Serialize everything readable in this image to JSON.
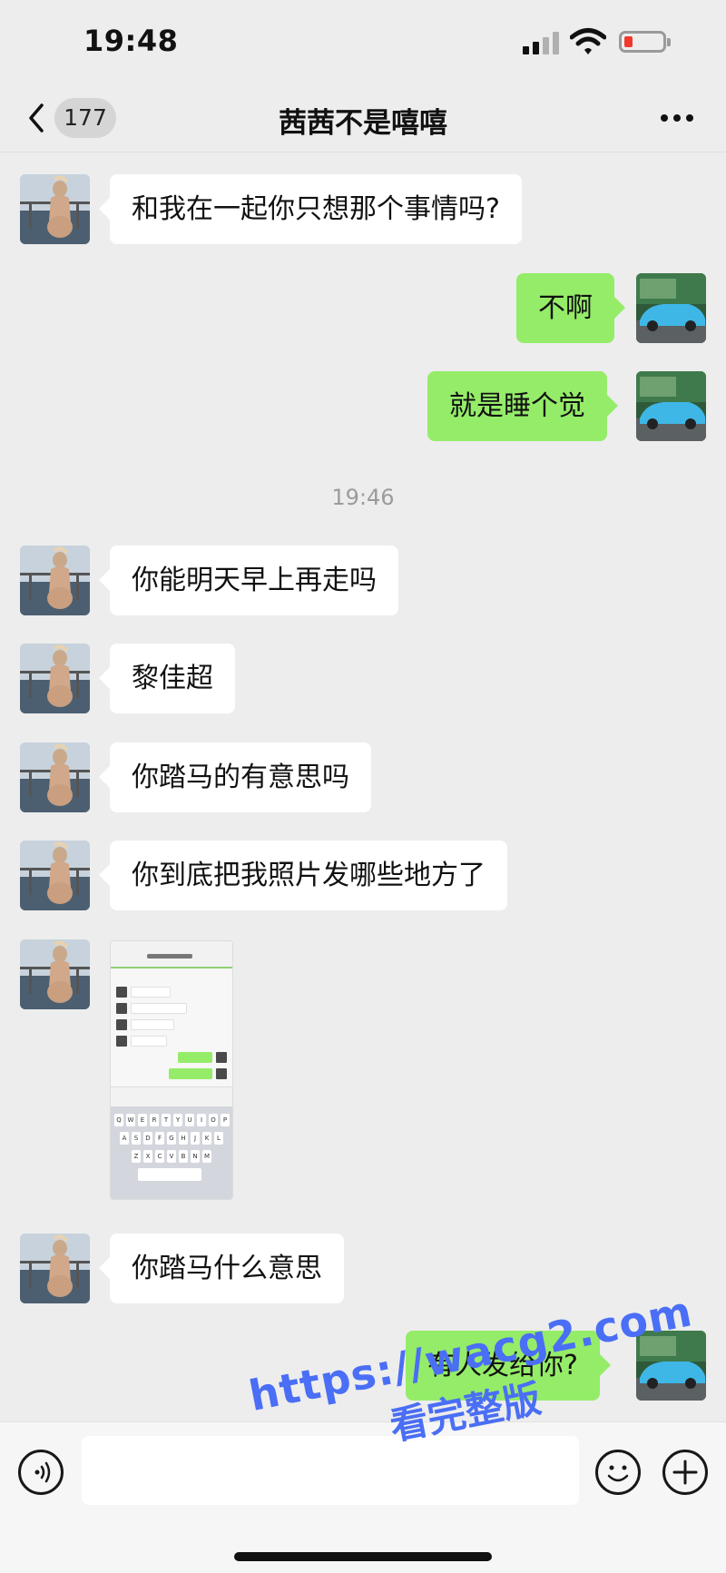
{
  "status_bar": {
    "time": "19:48"
  },
  "navbar": {
    "back_count": "177",
    "title": "茜茜不是嘻嘻"
  },
  "messages": [
    {
      "side": "in",
      "text": "和我在一起你只想那个事情吗?"
    },
    {
      "side": "out",
      "text": "不啊"
    },
    {
      "side": "out",
      "text": "就是睡个觉"
    },
    {
      "side": "in",
      "text": "你能明天早上再走吗"
    },
    {
      "side": "in",
      "text": "黎佳超"
    },
    {
      "side": "in",
      "text": "你踏马的有意思吗"
    },
    {
      "side": "in",
      "text": "你到底把我照片发哪些地方了"
    },
    {
      "side": "in",
      "type": "image",
      "text": ""
    },
    {
      "side": "in",
      "text": "你踏马什么意思"
    },
    {
      "side": "out",
      "text": "有人发给你?"
    }
  ],
  "timestamp": "19:46",
  "watermark": {
    "line1": "https://wacg2.com",
    "line2": "看完整版"
  },
  "colors": {
    "background": "#ededed",
    "incoming_bubble": "#ffffff",
    "outgoing_bubble": "#95ec69",
    "watermark": "#4a6ef5",
    "battery_low": "#f03a2e"
  },
  "icons": [
    "signal-icon",
    "wifi-icon",
    "battery-icon",
    "back-icon",
    "more-icon",
    "voice-icon",
    "emoji-icon",
    "plus-icon"
  ]
}
